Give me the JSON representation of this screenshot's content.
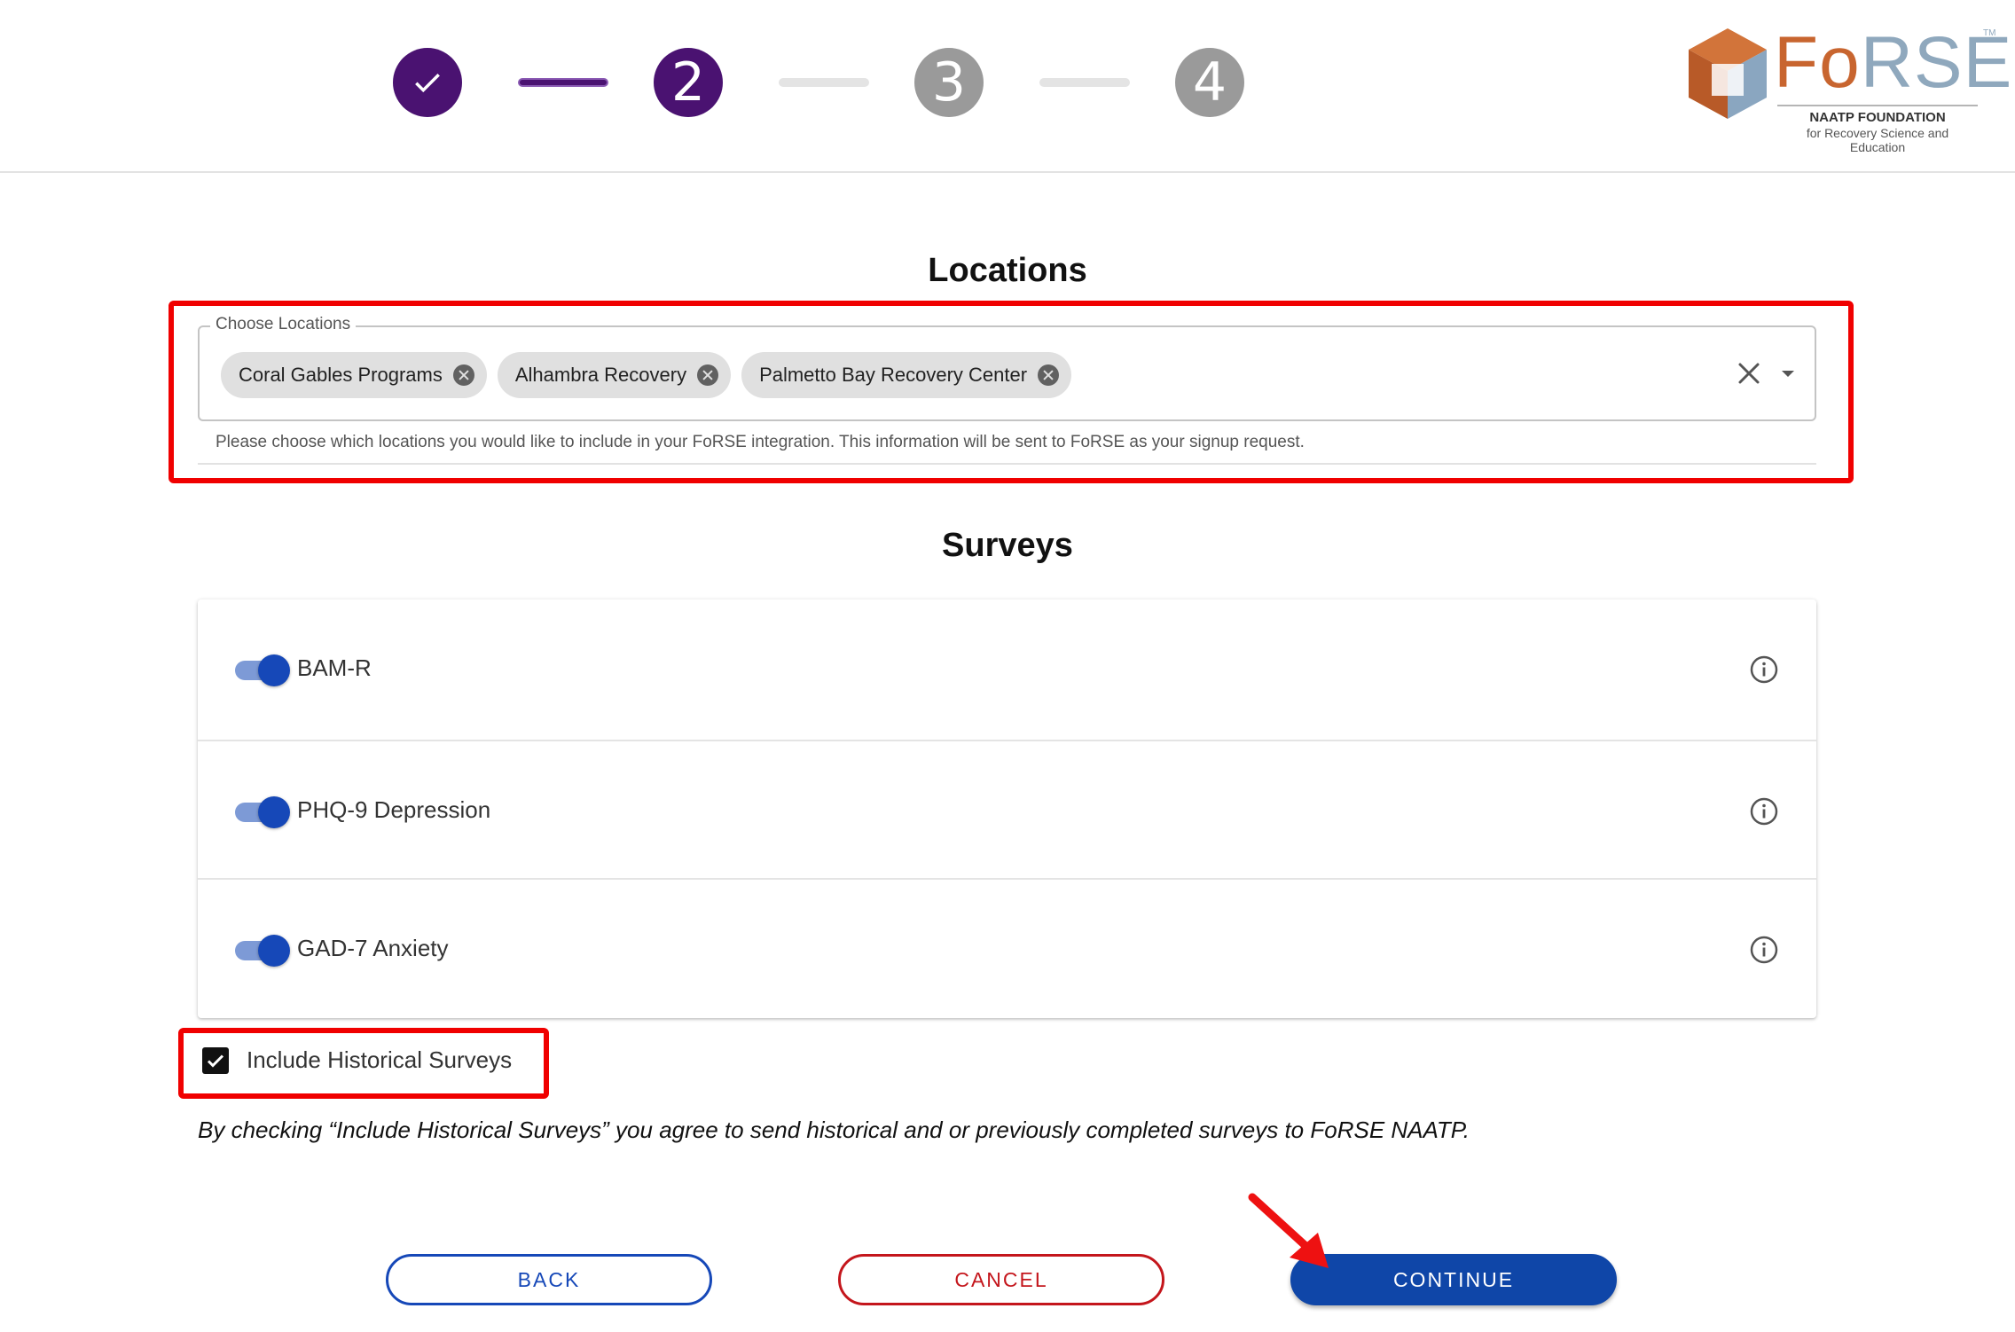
{
  "stepper": {
    "steps": [
      {
        "label": "",
        "state": "done"
      },
      {
        "label": "2",
        "state": "active"
      },
      {
        "label": "3",
        "state": "todo"
      },
      {
        "label": "4",
        "state": "todo"
      }
    ]
  },
  "logo": {
    "word_part1": "Fo",
    "word_part2": "RSE",
    "trademark": "TM",
    "line1": "NAATP FOUNDATION",
    "line2": "for Recovery Science and Education"
  },
  "locations": {
    "title": "Locations",
    "field_label": "Choose Locations",
    "selected": [
      "Coral Gables Programs",
      "Alhambra Recovery",
      "Palmetto Bay Recovery Center"
    ],
    "helper_text": "Please choose which locations you would like to include in your FoRSE integration. This information will be sent to FoRSE as your signup request."
  },
  "surveys": {
    "title": "Surveys",
    "items": [
      {
        "label": "BAM-R",
        "enabled": true
      },
      {
        "label": "PHQ-9 Depression",
        "enabled": true
      },
      {
        "label": "GAD-7 Anxiety",
        "enabled": true
      }
    ]
  },
  "historical": {
    "label": "Include Historical Surveys",
    "checked": true,
    "disclaimer": "By checking “Include Historical Surveys” you agree to send historical and or previously completed surveys to FoRSE NAATP."
  },
  "actions": {
    "back": "BACK",
    "cancel": "CANCEL",
    "continue": "CONTINUE"
  },
  "colors": {
    "step_active": "#4a1271",
    "step_todo": "#9a9a9a",
    "primary": "#0f46a8",
    "danger": "#c4161c",
    "highlight": "#f00000"
  }
}
